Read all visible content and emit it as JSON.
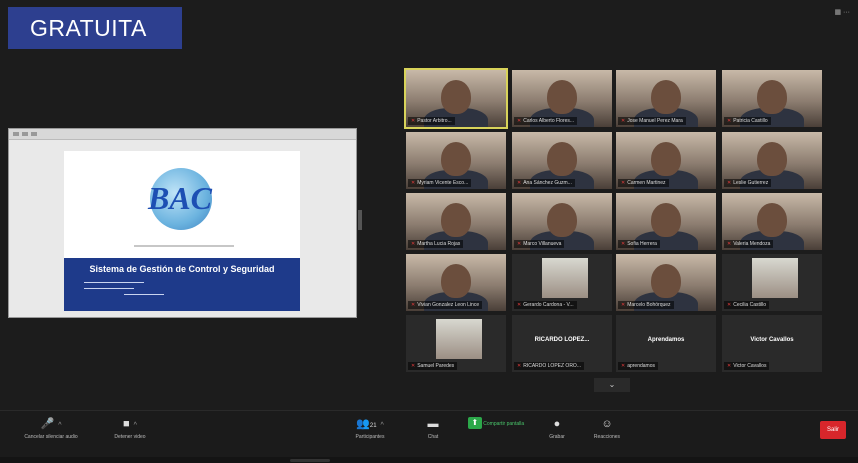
{
  "badge": {
    "label": "GRATUITA"
  },
  "view_button": {
    "label": "▦ ···"
  },
  "slide": {
    "logo_text": "BAC",
    "title": "Sistema de Gestión de Control y Seguridad"
  },
  "gallery": {
    "tiles": [
      {
        "name": "Pastor Arbitro...",
        "type": "video",
        "active": true
      },
      {
        "name": "Carlos Alberto Flores...",
        "type": "video"
      },
      {
        "name": "Jose Manuel Perez Mara",
        "type": "video"
      },
      {
        "name": "Patricia Castillo",
        "type": "video"
      },
      {
        "name": "Myriam Vicente Esco...",
        "type": "video"
      },
      {
        "name": "Ana Sánchez Guzm...",
        "type": "video"
      },
      {
        "name": "Carmen Martinez",
        "type": "video"
      },
      {
        "name": "Leslie Gutierrez",
        "type": "video"
      },
      {
        "name": "Martha Lucia Rojas",
        "type": "video"
      },
      {
        "name": "Marco Villanueva",
        "type": "video"
      },
      {
        "name": "Sofia Herrera",
        "type": "video"
      },
      {
        "name": "Valeria Mendoza",
        "type": "video"
      },
      {
        "name": "Vivian Gonzalez Leon Lince",
        "type": "video"
      },
      {
        "name": "Gerardo Cardona - V...",
        "type": "thumb"
      },
      {
        "name": "Marcelo Bohórquez",
        "type": "video"
      },
      {
        "name": "Cecilia Castillo",
        "type": "thumb"
      },
      {
        "name": "Samuel Paredes",
        "type": "thumb"
      },
      {
        "name": "RICARDO LOPEZ ORO...",
        "type": "text",
        "big": "RICARDO LOPEZ..."
      },
      {
        "name": "aprendamos",
        "type": "text",
        "big": "Aprendamos"
      },
      {
        "name": "Victor Cavallos",
        "type": "text",
        "big": "Victor Cavallos"
      }
    ],
    "pager": "⌄"
  },
  "toolbar": {
    "items": [
      {
        "label": "Cancelar silenciar audio",
        "icon": "🎤"
      },
      {
        "label": "Detener video",
        "icon": "■"
      },
      {
        "label": "Participantes",
        "icon": "👥",
        "count": "21"
      },
      {
        "label": "Chat",
        "icon": "▬"
      },
      {
        "label": "Compartir pantalla",
        "icon": "⬆"
      },
      {
        "label": "Grabar",
        "icon": "●"
      },
      {
        "label": "Reacciones",
        "icon": "☺"
      }
    ],
    "end_label": "Salir"
  },
  "colors": {
    "badge": "#2d3f8f",
    "share_green": "#2ca84a",
    "end_red": "#d8262b",
    "active_border": "#d8d35a"
  }
}
